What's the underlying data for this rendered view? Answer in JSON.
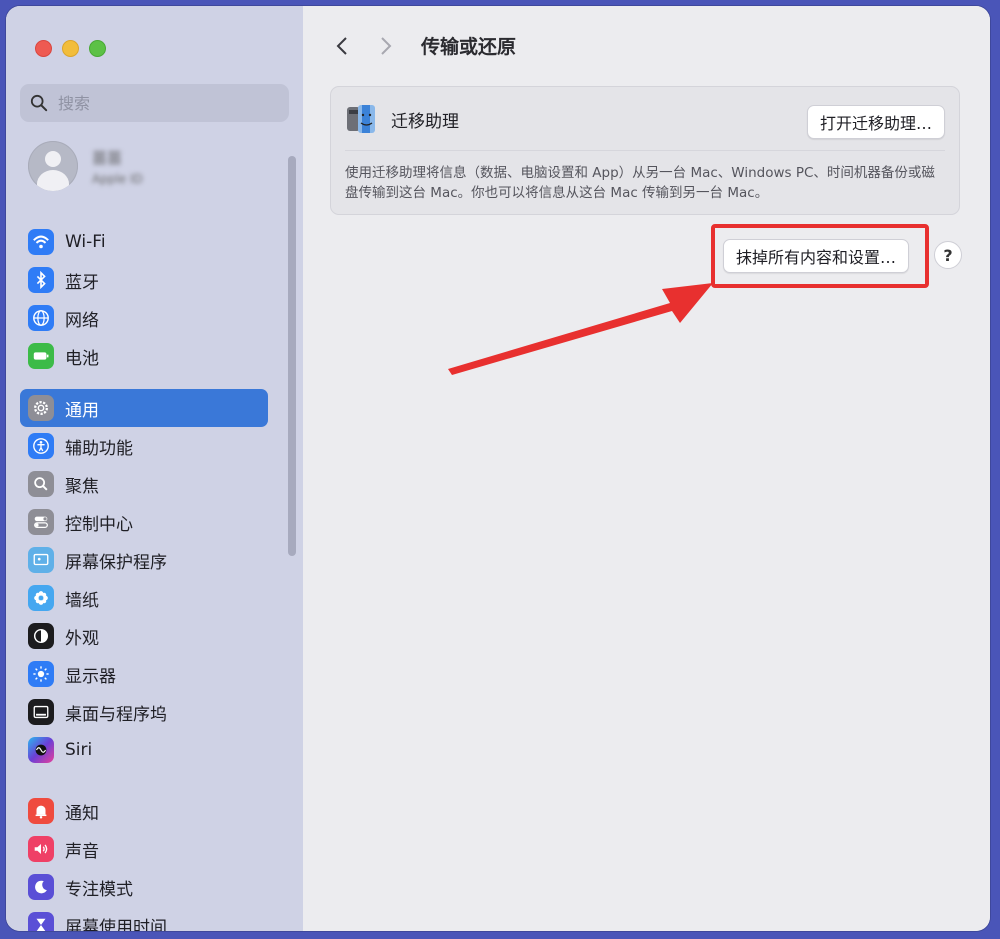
{
  "sidebar": {
    "search_placeholder": "搜索",
    "account": {
      "name": "苗苗",
      "subtitle": "Apple ID"
    },
    "groups": [
      [
        {
          "label": "Wi-Fi",
          "icon": "wifi-icon",
          "color": "#2f7cf6"
        },
        {
          "label": "蓝牙",
          "icon": "bluetooth-icon",
          "color": "#2f7cf6"
        },
        {
          "label": "网络",
          "icon": "globe-icon",
          "color": "#2f7cf6"
        },
        {
          "label": "电池",
          "icon": "battery-icon",
          "color": "#3cbb48"
        }
      ],
      [
        {
          "label": "通用",
          "icon": "gear-icon",
          "color": "#8e8e96",
          "active": true
        },
        {
          "label": "辅助功能",
          "icon": "accessibility-icon",
          "color": "#2f7cf6"
        },
        {
          "label": "聚焦",
          "icon": "magnifier-icon",
          "color": "#8e8e96"
        },
        {
          "label": "控制中心",
          "icon": "toggles-icon",
          "color": "#8e8e96"
        },
        {
          "label": "屏幕保护程序",
          "icon": "screensaver-icon",
          "color": "#5fb0e8"
        },
        {
          "label": "墙纸",
          "icon": "flower-icon",
          "color": "#45a7f0"
        },
        {
          "label": "外观",
          "icon": "appearance-icon",
          "color": "#1c1c1e"
        },
        {
          "label": "显示器",
          "icon": "sun-icon",
          "color": "#2f7cf6"
        },
        {
          "label": "桌面与程序坞",
          "icon": "dock-icon",
          "color": "#1c1c1e"
        },
        {
          "label": "Siri",
          "icon": "siri-icon",
          "color": "#6b3fd6"
        }
      ],
      [
        {
          "label": "通知",
          "icon": "bell-icon",
          "color": "#ef4b3e"
        },
        {
          "label": "声音",
          "icon": "speaker-icon",
          "color": "#ef4066"
        },
        {
          "label": "专注模式",
          "icon": "moon-icon",
          "color": "#5a4fd6"
        },
        {
          "label": "屏幕使用时间",
          "icon": "hourglass-icon",
          "color": "#5a4fd6"
        }
      ]
    ]
  },
  "main": {
    "title": "传输或还原",
    "migration": {
      "label": "迁移助理",
      "button": "打开迁移助理…",
      "description": "使用迁移助理将信息（数据、电脑设置和 App）从另一台 Mac、Windows PC、时间机器备份或磁盘传输到这台 Mac。你也可以将信息从这台 Mac 传输到另一台 Mac。"
    },
    "erase_button": "抹掉所有内容和设置…",
    "help": "?"
  },
  "colors": {
    "accent": "#3a78d8",
    "annotation": "#e8302f"
  }
}
